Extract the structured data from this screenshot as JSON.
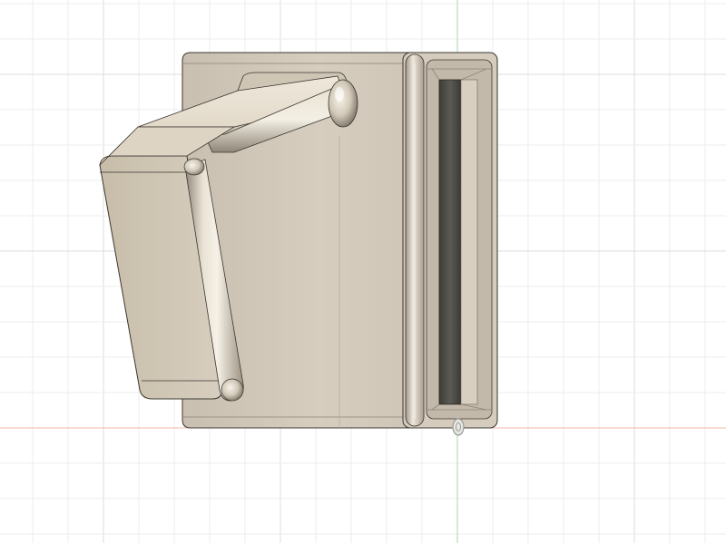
{
  "viewport": {
    "background": "#ffffff",
    "grid": {
      "visible": true,
      "minor_color": "#eeeeee",
      "major_color": "#dcdcdc"
    },
    "axes": {
      "horizontal_axis_color": "#f2b3a8",
      "vertical_axis_color": "#a6dba4"
    }
  },
  "model": {
    "body_color": "#d8cfc1",
    "shade_color": "#b8ae9e",
    "highlight_color": "#f2ece0",
    "edge_color": "#3a3630",
    "slot_color": "#4a4a44"
  },
  "icons": {
    "origin_marker": "origin-pivot-icon"
  }
}
